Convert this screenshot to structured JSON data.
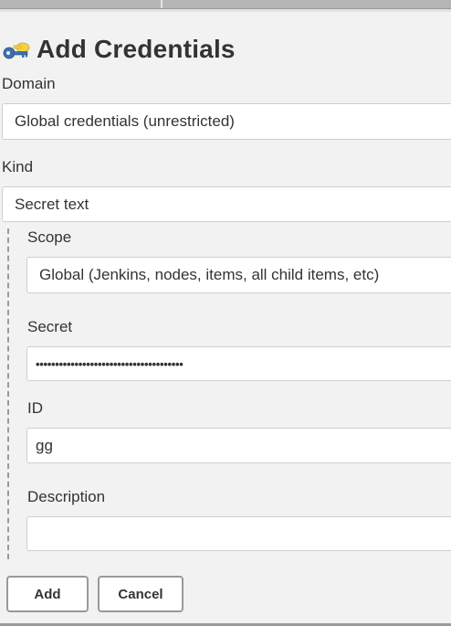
{
  "header": {
    "title": "Add Credentials",
    "icon": "credentials-key-icon"
  },
  "form": {
    "domain": {
      "label": "Domain",
      "value": "Global credentials (unrestricted)"
    },
    "kind": {
      "label": "Kind",
      "value": "Secret text"
    },
    "scope": {
      "label": "Scope",
      "value": "Global (Jenkins, nodes, items, all child items, etc)"
    },
    "secret": {
      "label": "Secret",
      "value": "••••••••••••••••••••••••••••••••••••••"
    },
    "id": {
      "label": "ID",
      "value": "gg"
    },
    "description": {
      "label": "Description",
      "value": ""
    }
  },
  "buttons": {
    "add_label": "Add",
    "cancel_label": "Cancel"
  },
  "colors": {
    "key_blue": "#3d6fb0",
    "key_yellow": "#f2d24a",
    "border": "#cfcfcf",
    "background": "#f2f2f2"
  }
}
